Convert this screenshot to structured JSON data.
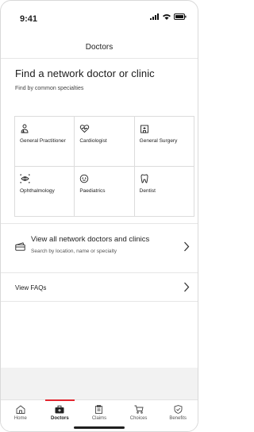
{
  "status": {
    "time": "9:41"
  },
  "nav": {
    "title": "Doctors"
  },
  "find": {
    "heading": "Find a network doctor or clinic",
    "subheading": "Find by common specialties"
  },
  "specialties": [
    {
      "label": "General Practitioner",
      "icon": "stethoscope-icon"
    },
    {
      "label": "Cardiologist",
      "icon": "heart-icon"
    },
    {
      "label": "General Surgery",
      "icon": "hospital-icon"
    },
    {
      "label": "Ophthalmology",
      "icon": "eye-icon"
    },
    {
      "label": "Paediatrics",
      "icon": "baby-face-icon"
    },
    {
      "label": "Dentist",
      "icon": "tooth-icon"
    }
  ],
  "view_all": {
    "title": "View all network doctors and clinics",
    "subtitle": "Search by location, name or specialty"
  },
  "faq": {
    "label": "View FAQs"
  },
  "tabs": [
    {
      "label": "Home",
      "icon": "home-icon"
    },
    {
      "label": "Doctors",
      "icon": "doctor-bag-icon"
    },
    {
      "label": "Claims",
      "icon": "clipboard-icon"
    },
    {
      "label": "Choices",
      "icon": "cart-icon"
    },
    {
      "label": "Benefits",
      "icon": "shield-check-icon"
    }
  ],
  "colors": {
    "accent": "#e3262f",
    "divider": "#e6e6e6",
    "tabbar_bg": "#f2f2f2"
  }
}
